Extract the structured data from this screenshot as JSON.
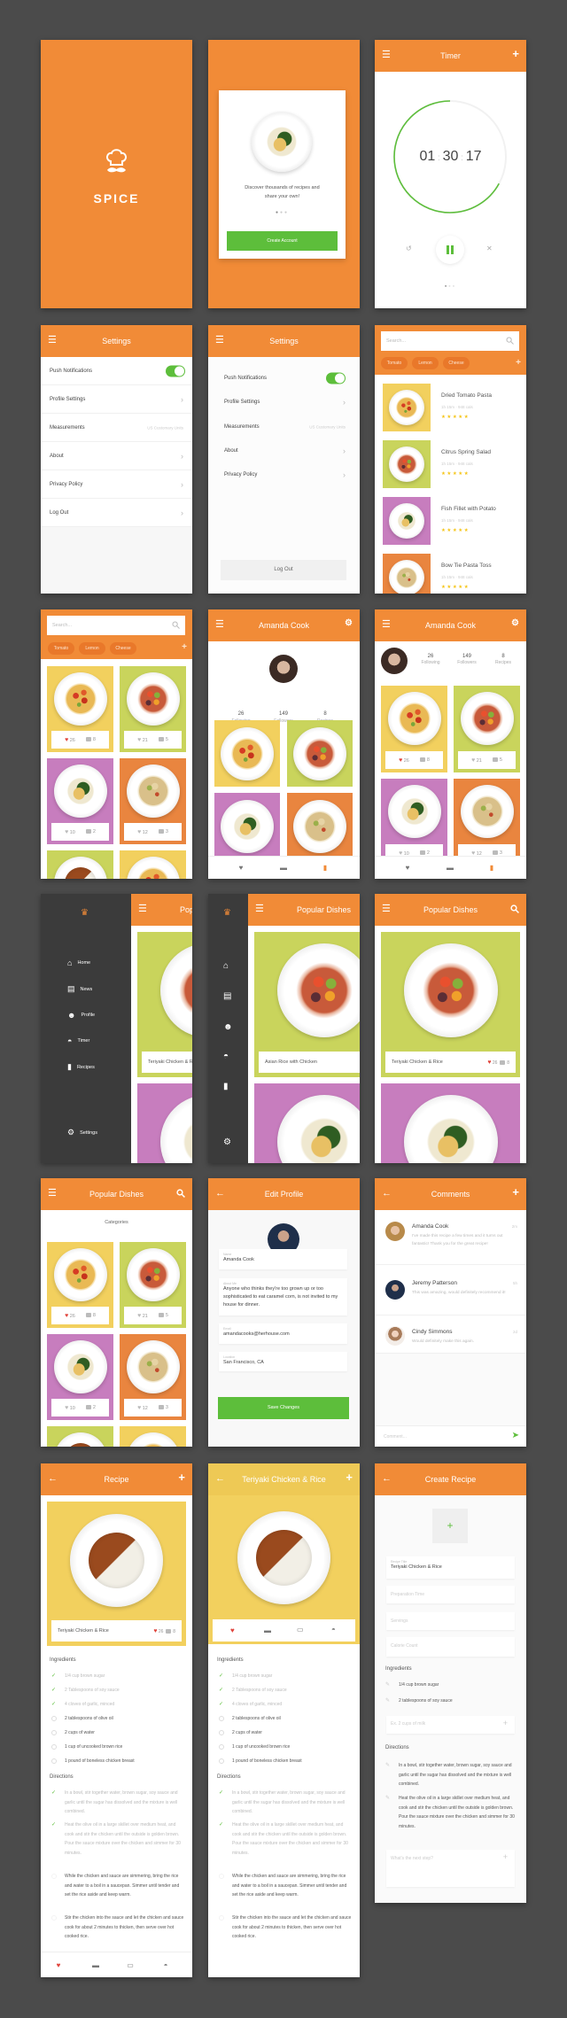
{
  "colors": {
    "accent": "#F18B37",
    "green": "#5DBE3B",
    "background": "#4B4B4B",
    "sidebar": "#3B3B3B",
    "heart": "#E0443C",
    "star": "#F5C518",
    "tile_yellow": "#F2D05E",
    "tile_lime": "#C9D45C",
    "tile_purple": "#C77DBE",
    "tile_orange": "#E9853F"
  },
  "splash": {
    "brand": "SPICE",
    "icon": "chef-hat-mustache-icon"
  },
  "onboarding": {
    "text": "Discover thousands of recipes and share your own!",
    "button": "Create Account",
    "active_page": 1,
    "page_count": 3
  },
  "timer": {
    "title": "Timer",
    "hours": "01",
    "minutes": "30",
    "seconds": "17",
    "progress": 0.67,
    "active_page": 1,
    "page_count": 3,
    "icons": [
      "menu-icon",
      "plus-icon",
      "reset-icon",
      "pause-icon",
      "close-icon"
    ]
  },
  "settings": {
    "title": "Settings",
    "push_notifications": {
      "label": "Push Notifications",
      "enabled": true
    },
    "profile_settings": "Profile Settings",
    "measurements": {
      "label": "Measurements",
      "value": "US Customary Units"
    },
    "about": "About",
    "privacy_policy": "Privacy Policy",
    "log_out": "Log Out"
  },
  "search": {
    "placeholder": "Search...",
    "tags": [
      "Tomato",
      "Lemon",
      "Cheese"
    ]
  },
  "dishes": [
    {
      "name": "Dried Tomato Pasta",
      "meta": "1h 15m · 948 cals",
      "rating": 5,
      "likes": "26",
      "comments": "8",
      "liked": true,
      "tile_color": "#F2D05E",
      "food": "pasta"
    },
    {
      "name": "Citrus Spring Salad",
      "meta": "1h 15m · 948 cals",
      "rating": 5,
      "likes": "21",
      "comments": "5",
      "liked": false,
      "tile_color": "#C9D45C",
      "food": "salad"
    },
    {
      "name": "Fish Fillet with Potato",
      "meta": "1h 15m · 948 cals",
      "rating": 5,
      "likes": "10",
      "comments": "2",
      "liked": false,
      "tile_color": "#C77DBE",
      "food": "fish"
    },
    {
      "name": "Bow Tie Pasta Toss",
      "meta": "1h 15m · 948 cals",
      "rating": 5,
      "likes": "12",
      "comments": "3",
      "liked": false,
      "tile_color": "#E9853F",
      "food": "bowtie"
    }
  ],
  "extra_tiles": [
    {
      "tile_color": "#C9D45C",
      "food": "chicken"
    },
    {
      "tile_color": "#F2D05E",
      "food": "pasta"
    }
  ],
  "profile": {
    "name": "Amanda Cook",
    "stats": [
      {
        "value": "26",
        "label": "Following"
      },
      {
        "value": "149",
        "label": "Followers"
      },
      {
        "value": "8",
        "label": "Recipes"
      }
    ]
  },
  "menu": {
    "items": [
      {
        "label": "Home",
        "icon": "home-icon"
      },
      {
        "label": "News",
        "icon": "news-icon"
      },
      {
        "label": "Profile",
        "icon": "profile-icon"
      },
      {
        "label": "Timer",
        "icon": "timer-icon"
      },
      {
        "label": "Recipes",
        "icon": "recipes-icon"
      }
    ],
    "settings": {
      "label": "Settings",
      "icon": "gear-icon"
    }
  },
  "popular": {
    "title": "Popular Dishes",
    "categories_label": "Categories",
    "featured": [
      {
        "name": "Teriyaki Chicken & Rice",
        "likes": "26",
        "comments": "8"
      },
      {
        "name": "Asian Rice with Chicken",
        "likes": "26",
        "comments": "8"
      }
    ]
  },
  "edit_profile": {
    "title": "Edit Profile",
    "fields": [
      {
        "label": "Name",
        "value": "Amanda Cook"
      },
      {
        "label": "About Me",
        "value": "Anyone who thinks they're too grown up or too sophisticated to eat caramel corn, is not invited to my house for dinner."
      },
      {
        "label": "Email",
        "value": "amandacooks@herhouse.com"
      },
      {
        "label": "Location",
        "value": "San Francisco, CA"
      }
    ],
    "save": "Save Changes"
  },
  "comments": {
    "title": "Comments",
    "items": [
      {
        "author": "Amanda Cook",
        "time": "2m",
        "text": "I've made this recipe a few times and it turns out fantastic! Thank you for the great recipe!"
      },
      {
        "author": "Jeremy Patterson",
        "time": "5h",
        "text": "This was amazing, would definitely recommend it!"
      },
      {
        "author": "Cindy Simmons",
        "time": "2d",
        "text": "Would definitely make this again."
      }
    ],
    "placeholder": "Comment..."
  },
  "recipe": {
    "title": "Recipe",
    "name": "Teriyaki Chicken & Rice",
    "likes": "26",
    "comments": "8",
    "ingredients_label": "Ingredients",
    "ingredients": [
      {
        "text": "1/4 cup brown sugar",
        "done": true
      },
      {
        "text": "2 Tablespoons of soy sauce",
        "done": true
      },
      {
        "text": "4 cloves of garlic, minced",
        "done": true
      },
      {
        "text": "2 tablespoons of olive oil",
        "done": false
      },
      {
        "text": "2 cups of water",
        "done": false
      },
      {
        "text": "1 cup of uncooked brown rice",
        "done": false
      },
      {
        "text": "1 pound of boneless chicken breast",
        "done": false
      }
    ],
    "directions_label": "Directions",
    "directions": [
      {
        "text": "In a bowl, stir together water, brown sugar, soy sauce and garlic until the sugar has dissolved and the mixture is well combined.",
        "done": true
      },
      {
        "text": "Heat the olive oil in a large skillet over medium heat, and cook and stir the chicken until the outside is golden brown. Pour the sauce mixture over the chicken and simmer for 30 minutes.",
        "done": true
      },
      {
        "text": "While the chicken and sauce are simmering, bring the rice and water to a boil in a saucepan. Simmer until tender and set the rice aside and keep warm.",
        "done": false
      },
      {
        "text": "Stir the chicken into the sauce and let the chicken and sauce cook for about 2 minutes to thicken, then serve over hot cooked rice.",
        "done": false
      }
    ]
  },
  "create_recipe": {
    "title": "Create Recipe",
    "title_field": {
      "label": "Recipe Title",
      "value": "Teriyaki Chicken & Rice"
    },
    "placeholders": [
      "Preparation Time",
      "Servings",
      "Calorie Count"
    ],
    "ingredients_label": "Ingredients",
    "ingredients": [
      "1/4 cup brown sugar",
      "2 tablespoons of soy sauce"
    ],
    "ingredient_placeholder": "Ex. 2 cups of milk",
    "directions_label": "Directions",
    "directions": [
      "In a bowl, stir together water, brown sugar, soy sauce and garlic until the sugar has dissolved and the mixture is well combined.",
      "Heat the olive oil in a large skillet over medium heat, and cook and stir the chicken until the outside is golden brown. Pour the sauce mixture over the chicken and simmer for 30 minutes."
    ],
    "step_placeholder": "What's the next step?"
  }
}
